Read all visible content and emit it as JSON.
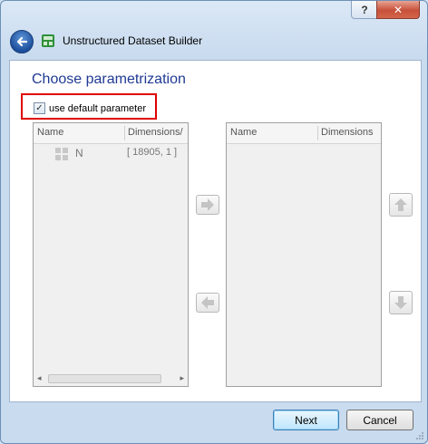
{
  "window": {
    "title": "Unstructured Dataset Builder",
    "help_label": "?",
    "close_label": "✕"
  },
  "page": {
    "heading": "Choose parametrization",
    "checkbox_label": "use default parameter",
    "checkbox_checked": true
  },
  "left_list": {
    "columns": [
      "Name",
      "Dimensions/"
    ],
    "rows": [
      {
        "name": "N",
        "dimensions": "[ 18905, 1 ]"
      }
    ]
  },
  "right_list": {
    "columns": [
      "Name",
      "Dimensions"
    ]
  },
  "buttons": {
    "next": "Next",
    "cancel": "Cancel"
  },
  "icons": {
    "back": "back-arrow-icon",
    "app": "dataset-builder-icon",
    "move_right": "arrow-right-icon",
    "move_left": "arrow-left-icon",
    "move_up": "arrow-up-icon",
    "move_down": "arrow-down-icon",
    "grid": "grid-icon"
  },
  "colors": {
    "heading": "#1f3a93",
    "highlight_border": "#e00000",
    "close_button": "#c8503b"
  }
}
